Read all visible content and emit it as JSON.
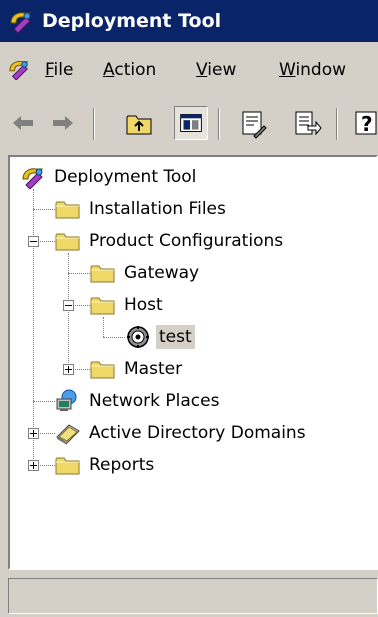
{
  "window": {
    "title": "Deployment Tool"
  },
  "menu": {
    "items": [
      {
        "mnemonic": "F",
        "rest": "ile"
      },
      {
        "mnemonic": "A",
        "rest": "ction"
      },
      {
        "mnemonic": "V",
        "rest": "iew"
      },
      {
        "mnemonic": "W",
        "rest": "indow"
      }
    ]
  },
  "toolbar": {
    "buttons": [
      "back-arrow-icon",
      "forward-arrow-icon",
      "up-folder-icon",
      "show-hide-tree-icon",
      "properties-icon",
      "export-list-icon",
      "help-icon"
    ]
  },
  "tree": {
    "root": "Deployment Tool",
    "installation_files": "Installation Files",
    "product_configurations": "Product Configurations",
    "gateway": "Gateway",
    "host": "Host",
    "test": "test",
    "master": "Master",
    "network_places": "Network Places",
    "active_directory_domains": "Active Directory Domains",
    "reports": "Reports"
  },
  "colors": {
    "title_bar": "#0a246a",
    "chrome": "#d4d0c8",
    "selection": "#d4d0c8",
    "folder": "#f0d868"
  }
}
